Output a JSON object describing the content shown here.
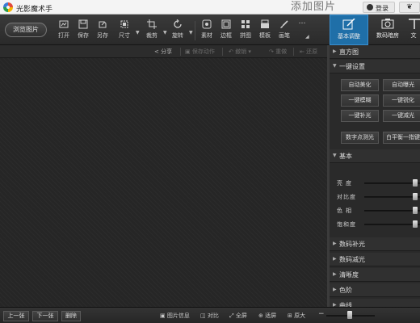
{
  "titlebar": {
    "app_title": "光影魔术手",
    "background_text": "添加图片",
    "login_label": "登录",
    "skin_glyph": "❦"
  },
  "toolbar": {
    "browse_label": "浏览图片",
    "tools": [
      {
        "icon": "open-icon",
        "label": "打开"
      },
      {
        "icon": "save-icon",
        "label": "保存"
      },
      {
        "icon": "save-as-icon",
        "label": "另存"
      },
      {
        "icon": "resize-icon",
        "label": "尺寸"
      },
      {
        "icon": "crop-icon",
        "label": "裁剪"
      },
      {
        "icon": "rotate-icon",
        "label": "旋转"
      },
      {
        "icon": "material-icon",
        "label": "素材"
      },
      {
        "icon": "border-icon",
        "label": "边框"
      },
      {
        "icon": "collage-icon",
        "label": "拼图"
      },
      {
        "icon": "template-icon",
        "label": "模板"
      },
      {
        "icon": "brush-icon",
        "label": "画笔"
      },
      {
        "icon": "more-icon",
        "label": "…"
      }
    ],
    "tabs": [
      {
        "icon": "basic-adjust-icon",
        "label": "基本调整",
        "active": true
      },
      {
        "icon": "camera-icon",
        "label": "数码暗房",
        "active": false
      },
      {
        "icon": "text-icon",
        "label": "文",
        "active": false
      }
    ]
  },
  "actionbar": {
    "share": "分享",
    "save_action": "保存动作",
    "undo": "撤销",
    "redo": "重做",
    "reset": "还原"
  },
  "panel": {
    "histogram": "直方图",
    "one_click": "一键设置",
    "buttons": [
      "自动美化",
      "自动曝光",
      "一键模糊",
      "一键锐化",
      "一键补光",
      "一键减光"
    ],
    "digital_point": "数字点测光",
    "white_balance": "白平衡一指键",
    "basic": "基本",
    "sliders": [
      {
        "label": "亮度",
        "value": 0.92
      },
      {
        "label": "对比度",
        "value": 0.92
      },
      {
        "label": "色相",
        "value": 0.92
      },
      {
        "label": "饱和度",
        "value": 0.92
      }
    ],
    "sections": [
      "数码补光",
      "数码减光",
      "清晰度",
      "色阶",
      "曲线"
    ]
  },
  "bottombar": {
    "prev": "上一张",
    "next": "下一张",
    "delete": "删除",
    "image_info": "图片信息",
    "compare": "对比",
    "fullscreen": "全屏",
    "fit": "适屏",
    "original": "原大",
    "zoom_minus": "−",
    "zoom_value": 0.48
  },
  "colors": {
    "accent": "#1f6fa8",
    "background": "#232323"
  }
}
